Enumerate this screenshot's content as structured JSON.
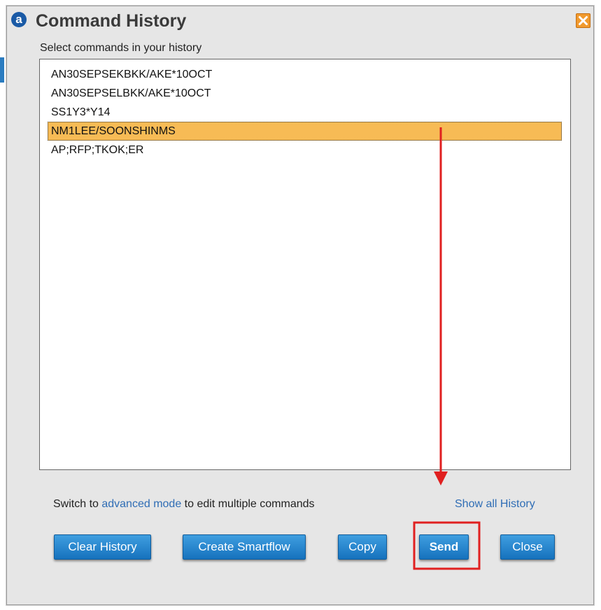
{
  "dialog": {
    "title": "Command History",
    "logo_glyph": "a",
    "logo_icon": "amadeus-logo-icon",
    "close_icon": "close-icon"
  },
  "instruction": "Select commands in your history",
  "history": {
    "items": [
      {
        "text": "AN30SEPSEKBKK/AKE*10OCT",
        "selected": false
      },
      {
        "text": "AN30SEPSELBKK/AKE*10OCT",
        "selected": false
      },
      {
        "text": "SS1Y3*Y14",
        "selected": false
      },
      {
        "text": "NM1LEE/SOONSHINMS",
        "selected": true
      },
      {
        "text": "AP;RFP;TKOK;ER",
        "selected": false
      }
    ]
  },
  "footer": {
    "prefix": "Switch to ",
    "link": "advanced mode",
    "suffix": " to edit multiple commands",
    "show_all": "Show all History"
  },
  "buttons": {
    "clear": "Clear History",
    "smartflow": "Create Smartflow",
    "copy": "Copy",
    "send": "Send",
    "close": "Close"
  },
  "colors": {
    "selection": "#f7bb55",
    "button": "#1e7fc8",
    "link": "#2f6db5",
    "annotation": "#e02020",
    "close_box": "#f19a2e"
  }
}
